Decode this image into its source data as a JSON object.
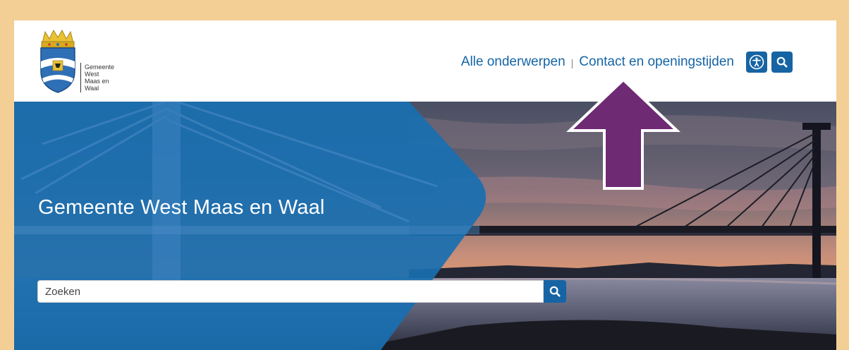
{
  "header": {
    "logo_text": "Gemeente West Maas en Waal",
    "logo_lines": [
      "Gemeente",
      "West",
      "Maas en",
      "Waal"
    ],
    "nav": {
      "topics": "Alle onderwerpen",
      "separator": "|",
      "contact": "Contact en openingstijden"
    },
    "icons": {
      "accessibility": "accessibility-icon",
      "search": "search-icon"
    }
  },
  "hero": {
    "title": "Gemeente West Maas en Waal",
    "search": {
      "placeholder": "Zoeken",
      "button_icon": "search-icon"
    }
  },
  "annotation": {
    "type": "arrow",
    "direction": "up",
    "target": "Contact en openingstijden"
  },
  "colors": {
    "page_border": "#f4cf95",
    "brand_blue": "#1664a3",
    "nav_link": "#1565a6",
    "arrow": "#6e2a72"
  }
}
